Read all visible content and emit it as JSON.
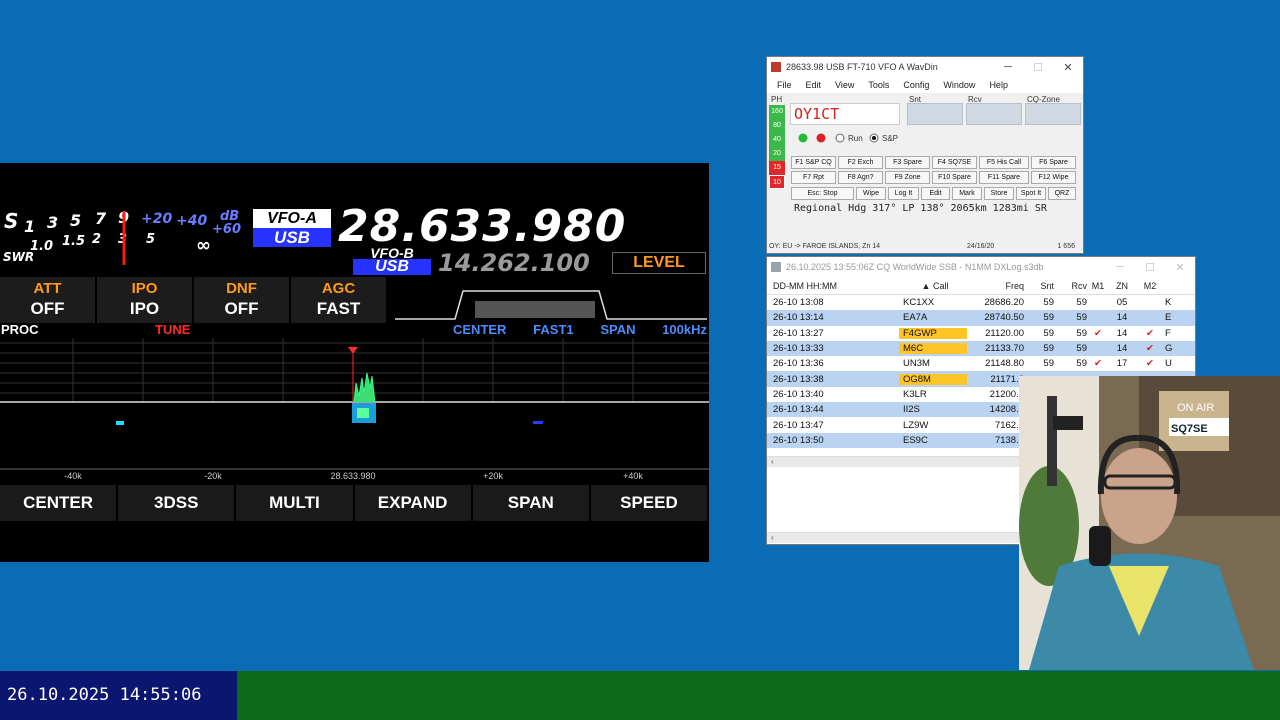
{
  "rig": {
    "meter": {
      "s_label": "S",
      "s_scale": [
        "1",
        "3",
        "5",
        "7",
        "9"
      ],
      "plus_scale": [
        "+20",
        "+40",
        "+60"
      ],
      "db_label": "dB",
      "swr_label": "SWR",
      "swr_scale": [
        "1.0",
        "1.5",
        "2",
        "3",
        "5",
        "∞"
      ]
    },
    "vfo_a": {
      "label": "VFO-A",
      "mode": "USB",
      "freq": "28.633.980"
    },
    "vfo_b": {
      "label": "VFO-B",
      "mode": "USB",
      "freq": "14.262.100"
    },
    "level_label": "LEVEL",
    "functions": [
      {
        "title": "ATT",
        "value": "OFF"
      },
      {
        "title": "IPO",
        "value": "IPO"
      },
      {
        "title": "DNF",
        "value": "OFF"
      },
      {
        "title": "AGC",
        "value": "FAST"
      }
    ],
    "proc_label": "PROC",
    "tune_label": "TUNE",
    "scope_status": {
      "mode": "CENTER",
      "speed": "FAST1",
      "span_label": "SPAN",
      "span_value": "100kHz"
    },
    "scope_ticks": [
      "-40k",
      "-20k",
      "28.633.980",
      "+20k",
      "+40k"
    ],
    "keys": [
      "CENTER",
      "3DSS",
      "MULTI",
      "EXPAND",
      "SPAN",
      "SPEED"
    ],
    "colors": {
      "orange": "#ff9a1a",
      "blue_badge": "#2633ff",
      "tune_red": "#ff2a2a",
      "status_blue": "#4d8cff"
    }
  },
  "wavdin": {
    "title": "28633.98 USB FT-710 VFO A  WavDin",
    "menu": [
      "File",
      "Edit",
      "View",
      "Tools",
      "Config",
      "Window",
      "Help"
    ],
    "ph_label": "PH",
    "field_labels": {
      "snt": "Snt",
      "rcv": "Rcv",
      "cqzone": "CQ-Zone"
    },
    "callsign": "OY1CT",
    "bands": [
      "160",
      "80",
      "40",
      "20",
      "15",
      "10"
    ],
    "radio": {
      "run": "Run",
      "sp": "S&P"
    },
    "fkeys_row1": [
      "F1 S&P CQ",
      "F2 Exch",
      "F3 Spare",
      "F4 SQ7SE",
      "F5 His Call",
      "F6 Spare"
    ],
    "fkeys_row2": [
      "F7 Rpt",
      "F8 Agn?",
      "F9 Zone",
      "F10 Spare",
      "F11 Spare",
      "F12 Wipe"
    ],
    "fkeys_row3": [
      "Esc: Stop",
      "Wipe",
      "Log It",
      "Edit",
      "Mark",
      "Store",
      "Spot It",
      "QRZ"
    ],
    "info_line": "Regional Hdg 317° LP 138° 2065km 1283mi SR",
    "status": {
      "left": "OY: EU -> FAROE ISLANDS, Zn 14",
      "mid": "24/16/20",
      "right": "1 656"
    }
  },
  "log": {
    "title": "26.10.2025 13:55:06Z  CQ WorldWide SSB - N1MM DXLog.s3db",
    "headers": {
      "dt": "DD-MM HH:MM",
      "call": "Call",
      "freq": "Freq",
      "snt": "Snt",
      "rcv": "Rcv",
      "m1": "M1",
      "zn": "ZN",
      "m2": "M2"
    },
    "rows": [
      {
        "dt": "26-10 13:08",
        "call": "KC1XX",
        "freq": "28686.20",
        "snt": "59",
        "rcv": "59",
        "m1": "",
        "zn": "05",
        "m2": "",
        "x": "K"
      },
      {
        "dt": "26-10 13:14",
        "call": "EA7A",
        "freq": "28740.50",
        "snt": "59",
        "rcv": "59",
        "m1": "",
        "zn": "14",
        "m2": "",
        "x": "E"
      },
      {
        "dt": "26-10 13:27",
        "call": "F4GWP",
        "freq": "21120.00",
        "snt": "59",
        "rcv": "59",
        "m1": "✔",
        "zn": "14",
        "m2": "✔",
        "x": "F"
      },
      {
        "dt": "26-10 13:33",
        "call": "M6C",
        "freq": "21133.70",
        "snt": "59",
        "rcv": "59",
        "m1": "",
        "zn": "14",
        "m2": "✔",
        "x": "G"
      },
      {
        "dt": "26-10 13:36",
        "call": "UN3M",
        "freq": "21148.80",
        "snt": "59",
        "rcv": "59",
        "m1": "✔",
        "zn": "17",
        "m2": "✔",
        "x": "U"
      },
      {
        "dt": "26-10 13:38",
        "call": "OG8M",
        "freq": "21171.0",
        "snt": "",
        "rcv": "",
        "m1": "",
        "zn": "",
        "m2": "",
        "x": ""
      },
      {
        "dt": "26-10 13:40",
        "call": "K3LR",
        "freq": "21200.4",
        "snt": "",
        "rcv": "",
        "m1": "",
        "zn": "",
        "m2": "",
        "x": ""
      },
      {
        "dt": "26-10 13:44",
        "call": "II2S",
        "freq": "14208.0",
        "snt": "",
        "rcv": "",
        "m1": "",
        "zn": "",
        "m2": "",
        "x": ""
      },
      {
        "dt": "26-10 13:47",
        "call": "LZ9W",
        "freq": "7162.7",
        "snt": "",
        "rcv": "",
        "m1": "",
        "zn": "",
        "m2": "",
        "x": ""
      },
      {
        "dt": "26-10 13:50",
        "call": "ES9C",
        "freq": "7138.0",
        "snt": "",
        "rcv": "",
        "m1": "",
        "zn": "",
        "m2": "",
        "x": ""
      }
    ],
    "highlight_color": "#ffc425",
    "alt_row_color": "#b9d3f0"
  },
  "webcam": {
    "sign_text": "SQ7SE",
    "air_text": "ON AIR"
  },
  "statusbar": {
    "datetime": "26.10.2025 14:55:06"
  }
}
